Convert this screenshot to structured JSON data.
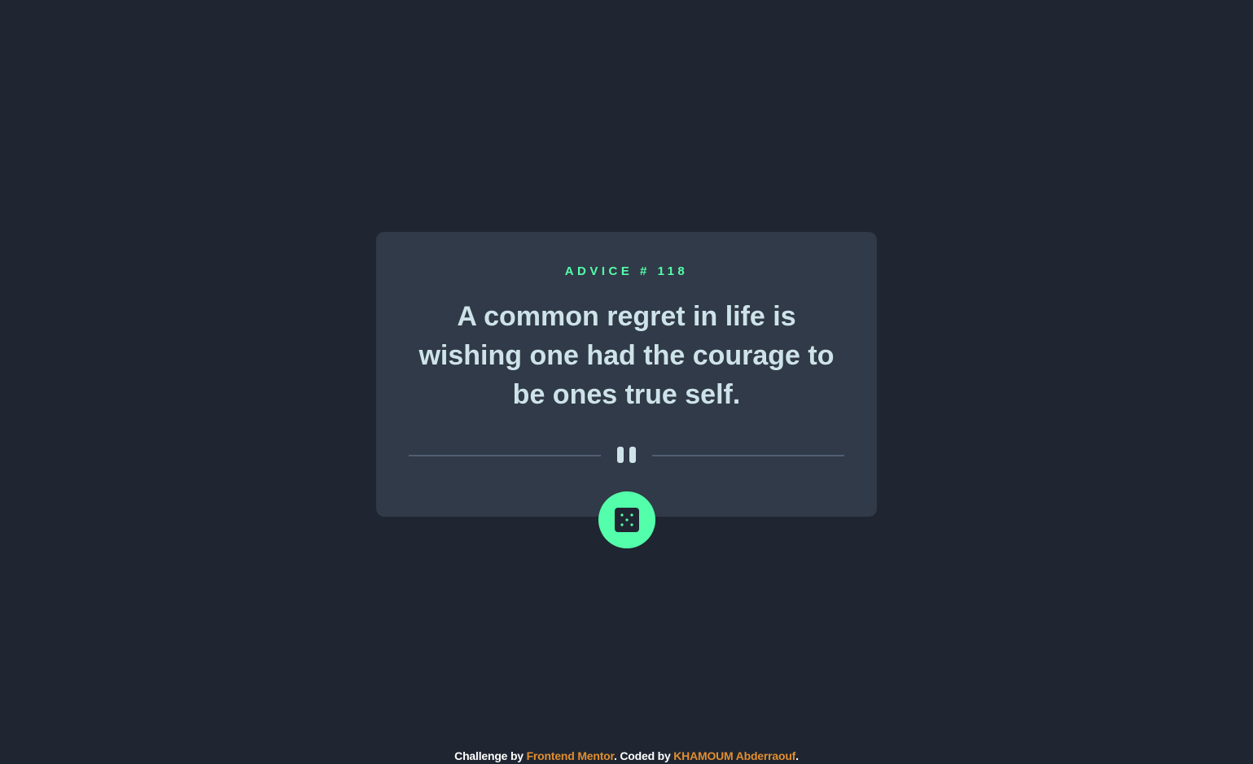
{
  "card": {
    "advice_label": "ADVICE # 118",
    "quote": "A common regret in life is wishing one had the courage to be ones true self."
  },
  "icons": {
    "divider": "pause-icon",
    "button": "dice-icon"
  },
  "footer": {
    "challenge_prefix": "Challenge by ",
    "challenge_link": "Frontend Mentor",
    "coded_prefix": ". Coded by ",
    "coded_link": "KHAMOUM Abderraouf",
    "suffix": "."
  },
  "colors": {
    "background": "#1f2631",
    "card": "#313a48",
    "accent": "#53ffaa",
    "quote_text": "#cee3e9",
    "divider": "#4f5d74",
    "link": "#e28d2f"
  }
}
